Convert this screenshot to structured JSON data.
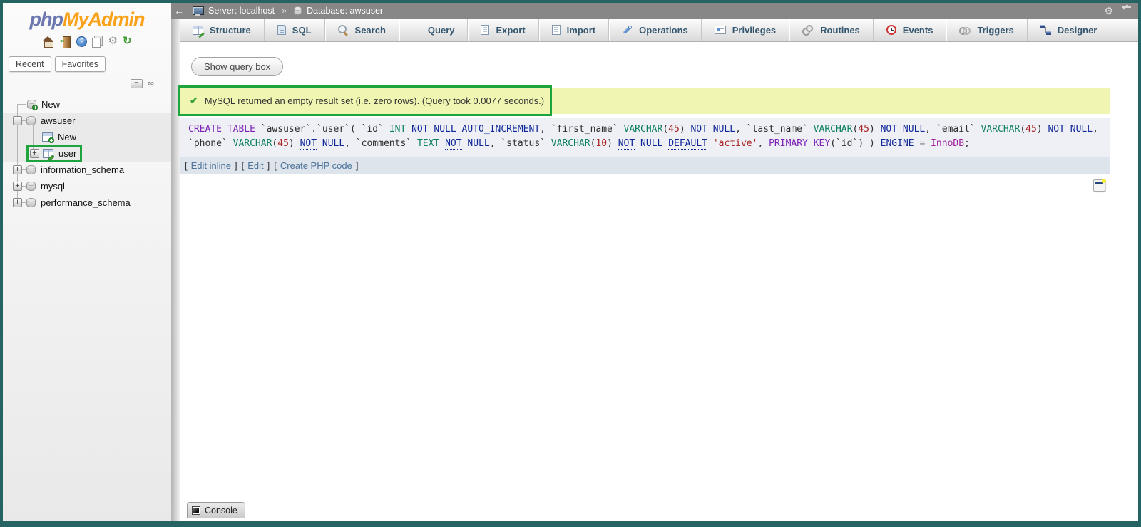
{
  "logo": {
    "prefix": "php",
    "suffix": "MyAdmin"
  },
  "colors": {
    "accent_teal": "#266363",
    "annotation_green": "#1ea43c",
    "success_bg": "#f1f5b2",
    "tab_text": "#34576f"
  },
  "sidebar": {
    "header_icons": {
      "help_glyph": "?",
      "settings_glyph": "⚙",
      "refresh_glyph": "↻"
    },
    "panel_tabs": [
      {
        "label": "Recent"
      },
      {
        "label": "Favorites"
      }
    ],
    "collapse_minus": "−",
    "link_glyph": "∞",
    "tree": [
      {
        "label": "New"
      },
      {
        "label": "awsuser",
        "expander": "−"
      },
      {
        "label": "New"
      },
      {
        "label": "user",
        "expander": "+"
      },
      {
        "label": "information_schema",
        "expander": "+"
      },
      {
        "label": "mysql",
        "expander": "+"
      },
      {
        "label": "performance_schema",
        "expander": "+"
      }
    ]
  },
  "topbar": {
    "back_arrow": "←",
    "server": "Server: localhost",
    "separator": "»",
    "database": "Database: awsuser",
    "gear_glyph": "⚙"
  },
  "tabs": [
    {
      "label": "Structure",
      "icon": "i-structure"
    },
    {
      "label": "SQL",
      "icon": "i-sqlpage"
    },
    {
      "label": "Search",
      "icon": "i-search"
    },
    {
      "label": "Query",
      "icon": "i-qcyl"
    },
    {
      "label": "Export",
      "icon": "i-page exp"
    },
    {
      "label": "Import",
      "icon": "i-page imp"
    },
    {
      "label": "Operations",
      "icon": "i-wrench"
    },
    {
      "label": "Privileges",
      "icon": "i-card"
    },
    {
      "label": "Routines",
      "icon": "i-gears"
    },
    {
      "label": "Events",
      "icon": "i-clock"
    },
    {
      "label": "Triggers",
      "icon": "i-rings"
    },
    {
      "label": "Designer",
      "icon": "i-designer"
    }
  ],
  "main": {
    "show_query_box": "Show query box",
    "success": {
      "check_glyph": "✔",
      "text": "MySQL returned an empty result set (i.e. zero rows). (Query took 0.0077 seconds.)"
    },
    "sql": {
      "tokens": [
        {
          "t": "CREATE",
          "c": "k1 u"
        },
        {
          "t": " ",
          "c": "pl"
        },
        {
          "t": "TABLE",
          "c": "k1 u"
        },
        {
          "t": " `awsuser`.`user`( `id` ",
          "c": "pl"
        },
        {
          "t": "INT",
          "c": "ty"
        },
        {
          "t": " ",
          "c": "pl"
        },
        {
          "t": "NOT",
          "c": "k2 u"
        },
        {
          "t": " ",
          "c": "pl"
        },
        {
          "t": "NULL",
          "c": "k2"
        },
        {
          "t": " ",
          "c": "pl"
        },
        {
          "t": "AUTO_INCREMENT",
          "c": "k2"
        },
        {
          "t": ", `first_name` ",
          "c": "pl"
        },
        {
          "t": "VARCHAR",
          "c": "ty"
        },
        {
          "t": "(",
          "c": "pl"
        },
        {
          "t": "45",
          "c": "nu"
        },
        {
          "t": ") ",
          "c": "pl"
        },
        {
          "t": "NOT",
          "c": "k2 u"
        },
        {
          "t": " ",
          "c": "pl"
        },
        {
          "t": "NULL",
          "c": "k2"
        },
        {
          "t": ", `last_name` ",
          "c": "pl"
        },
        {
          "t": "VARCHAR",
          "c": "ty"
        },
        {
          "t": "(",
          "c": "pl"
        },
        {
          "t": "45",
          "c": "nu"
        },
        {
          "t": ") ",
          "c": "pl"
        },
        {
          "t": "NOT",
          "c": "k2 u"
        },
        {
          "t": " ",
          "c": "pl"
        },
        {
          "t": "NULL",
          "c": "k2"
        },
        {
          "t": ", `email` ",
          "c": "pl"
        },
        {
          "t": "VARCHAR",
          "c": "ty"
        },
        {
          "t": "(",
          "c": "pl"
        },
        {
          "t": "45",
          "c": "nu"
        },
        {
          "t": ") ",
          "c": "pl"
        },
        {
          "t": "NOT",
          "c": "k2 u"
        },
        {
          "t": " ",
          "c": "pl"
        },
        {
          "t": "NULL",
          "c": "k2"
        },
        {
          "t": ", `phone` ",
          "c": "pl"
        },
        {
          "t": "VARCHAR",
          "c": "ty"
        },
        {
          "t": "(",
          "c": "pl"
        },
        {
          "t": "45",
          "c": "nu"
        },
        {
          "t": ") ",
          "c": "pl"
        },
        {
          "t": "NOT",
          "c": "k2 u"
        },
        {
          "t": " ",
          "c": "pl"
        },
        {
          "t": "NULL",
          "c": "k2"
        },
        {
          "t": ", `comments` ",
          "c": "pl"
        },
        {
          "t": "TEXT",
          "c": "ty"
        },
        {
          "t": " ",
          "c": "pl"
        },
        {
          "t": "NOT",
          "c": "k2 u"
        },
        {
          "t": " ",
          "c": "pl"
        },
        {
          "t": "NULL",
          "c": "k2"
        },
        {
          "t": ", `status` ",
          "c": "pl"
        },
        {
          "t": "VARCHAR",
          "c": "ty"
        },
        {
          "t": "(",
          "c": "pl"
        },
        {
          "t": "10",
          "c": "nu"
        },
        {
          "t": ") ",
          "c": "pl"
        },
        {
          "t": "NOT",
          "c": "k2 u"
        },
        {
          "t": " ",
          "c": "pl"
        },
        {
          "t": "NULL",
          "c": "k2"
        },
        {
          "t": " ",
          "c": "pl"
        },
        {
          "t": "DEFAULT",
          "c": "k2 u"
        },
        {
          "t": " ",
          "c": "pl"
        },
        {
          "t": "'active'",
          "c": "st"
        },
        {
          "t": ", ",
          "c": "pl"
        },
        {
          "t": "PRIMARY",
          "c": "k1"
        },
        {
          "t": " ",
          "c": "pl"
        },
        {
          "t": "KEY",
          "c": "k1"
        },
        {
          "t": "(`id`) ) ",
          "c": "pl"
        },
        {
          "t": "ENGINE",
          "c": "k2"
        },
        {
          "t": " = ",
          "c": "op"
        },
        {
          "t": "InnoDB",
          "c": "in"
        },
        {
          "t": ";",
          "c": "pl"
        }
      ]
    },
    "links": {
      "open": "[",
      "close": "]",
      "items": [
        {
          "label": "Edit inline"
        },
        {
          "label": "Edit"
        },
        {
          "label": "Create PHP code"
        }
      ]
    },
    "console": {
      "label": "Console"
    }
  }
}
